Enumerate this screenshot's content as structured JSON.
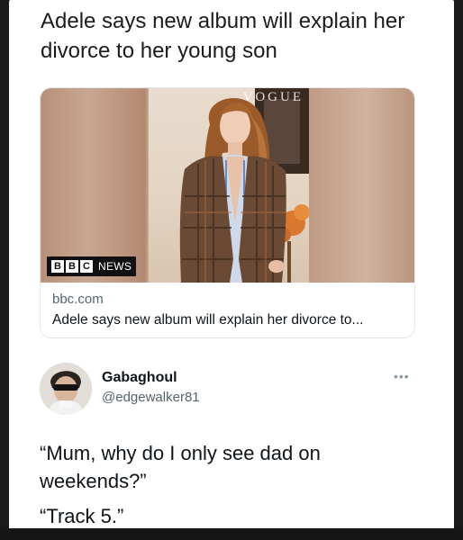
{
  "post": {
    "headline": "Adele says new album will explain her divorce to her young son"
  },
  "link_card": {
    "masthead": "VOGUE",
    "badge_letters": [
      "B",
      "B",
      "C"
    ],
    "badge_news": "NEWS",
    "domain": "bbc.com",
    "title": "Adele says new album will explain her divorce to..."
  },
  "tweet": {
    "author_name": "Gabaghoul",
    "author_handle": "@edgewalker81",
    "more_icon": "more-horizontal-icon",
    "line1": "“Mum, why do I only see dad on weekends?”",
    "line2": "“Track 5.”"
  }
}
